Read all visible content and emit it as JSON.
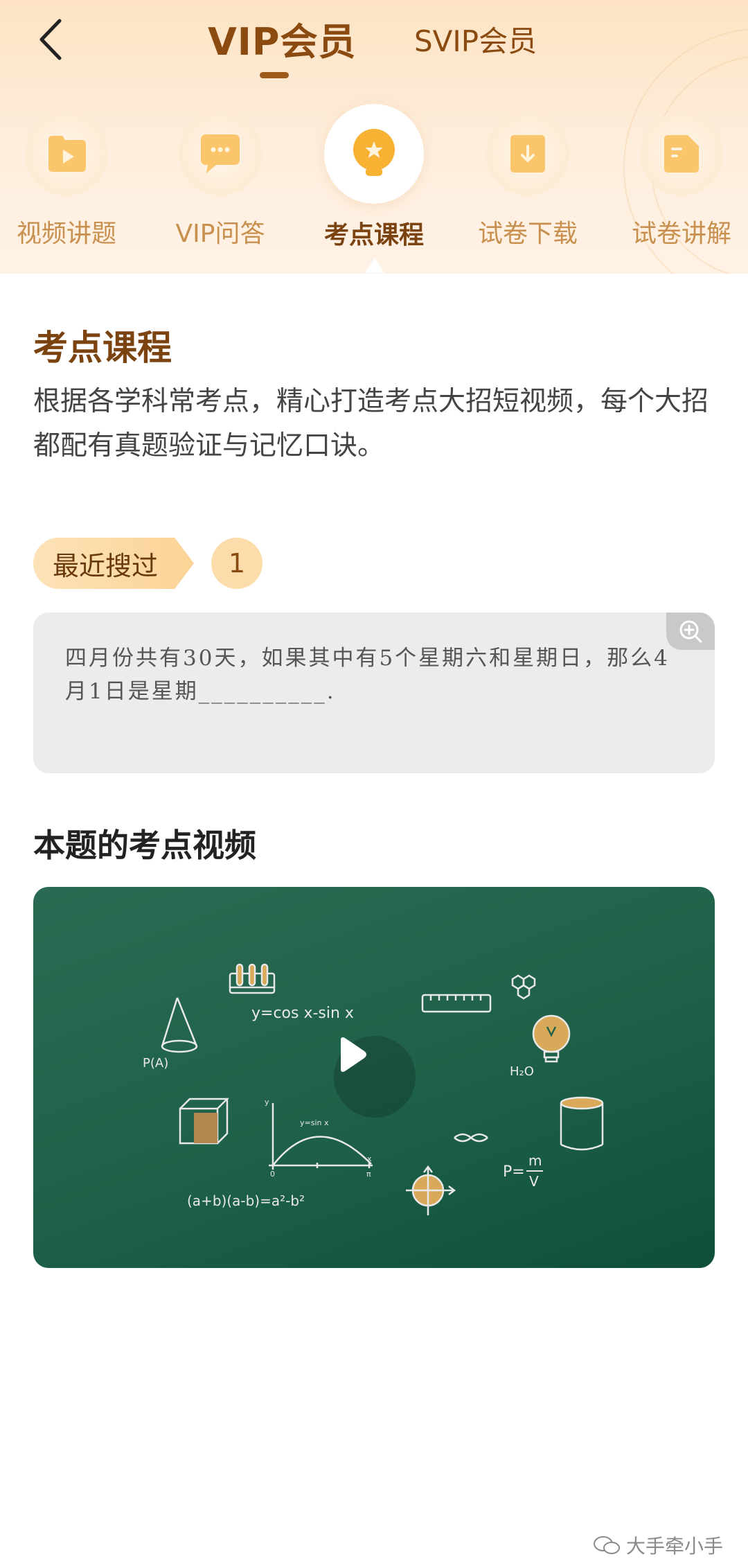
{
  "nav": {
    "back_icon": "chevron-left-icon",
    "tabs": [
      {
        "label": "VIP会员",
        "active": true
      },
      {
        "label": "SVIP会员",
        "active": false
      }
    ]
  },
  "categories": [
    {
      "label": "视频讲题",
      "icon": "video-play-icon"
    },
    {
      "label": "VIP问答",
      "icon": "chat-bubble-icon"
    },
    {
      "label": "考点课程",
      "icon": "lightbulb-star-icon",
      "active": true
    },
    {
      "label": "试卷下载",
      "icon": "download-icon"
    },
    {
      "label": "试卷讲解",
      "icon": "document-icon"
    }
  ],
  "section": {
    "title": "考点课程",
    "description": "根据各学科常考点，精心打造考点大招短视频，每个大招都配有真题验证与记忆口诀。"
  },
  "recent": {
    "label": "最近搜过",
    "count": "1"
  },
  "question": {
    "text": "四月份共有30天，如果其中有5个星期六和星期日，那么4月1日是星期__________.",
    "zoom_icon": "zoom-in-icon"
  },
  "video": {
    "title": "本题的考点视频",
    "play_icon": "play-icon",
    "formulas": {
      "f1": "y=cos x-sin x",
      "f2": "P(A)",
      "f3": "H₂O",
      "f4": "(a+b)(a-b)=a²-b²",
      "f5": "y=sin x",
      "f6": "P=",
      "f6_num": "m",
      "f6_den": "V",
      "axis_x": "x",
      "axis_y": "y",
      "axis_0": "0",
      "axis_pi": "π"
    }
  },
  "watermark": {
    "text": "大手牵小手"
  },
  "colors": {
    "accent": "#8a4a10",
    "header_bg": "#fde3c3",
    "chalkboard": "#1f6249",
    "chalk_gold": "#e2c28a"
  }
}
